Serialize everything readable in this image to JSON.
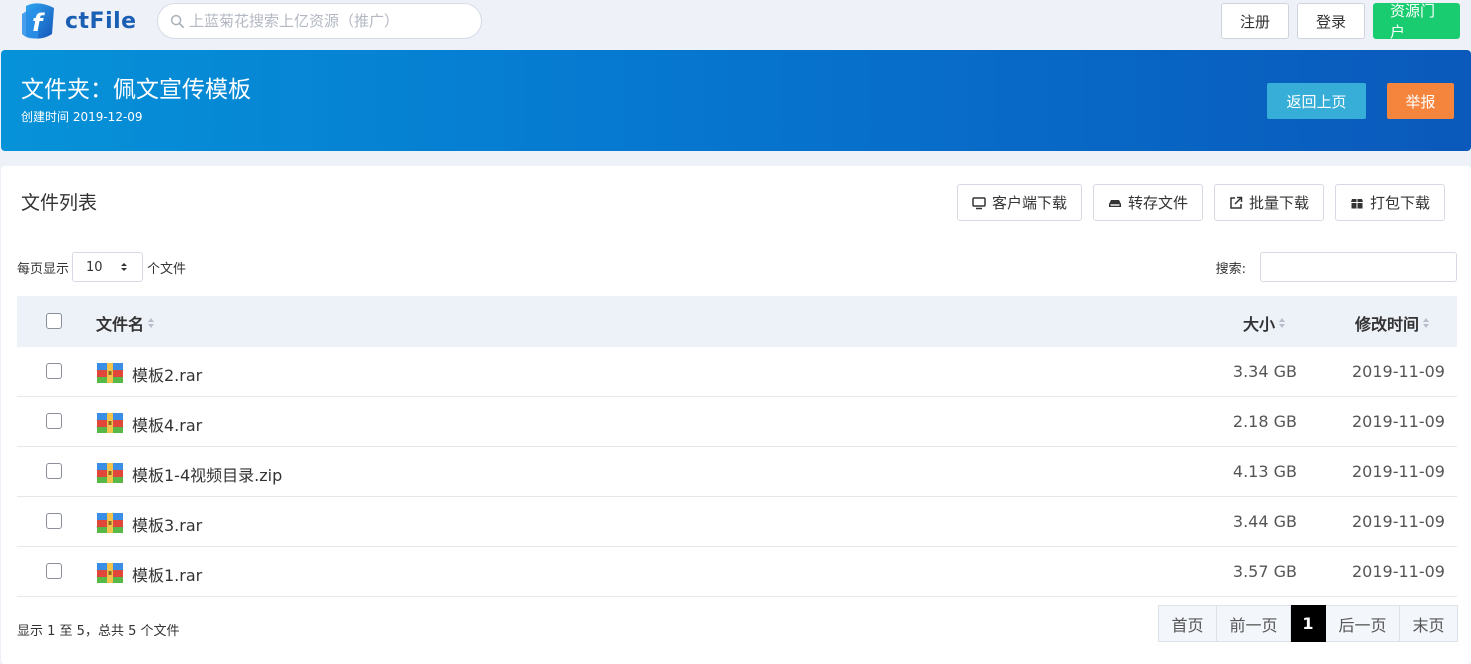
{
  "header": {
    "logo_text": "ctFile",
    "search_placeholder": "上蓝菊花搜索上亿资源（推广）",
    "register_label": "注册",
    "login_label": "登录",
    "portal_label": "资源门户"
  },
  "banner": {
    "title": "文件夹：佩文宣传模板",
    "created": "创建时间 2019-12-09",
    "back_label": "返回上页",
    "report_label": "举报"
  },
  "list": {
    "title": "文件列表",
    "tools": {
      "client_download": "客户端下载",
      "save_files": "转存文件",
      "batch_download": "批量下载",
      "pack_download": "打包下载"
    },
    "per_page_prefix": "每页显示",
    "per_page_value": "10",
    "per_page_suffix": "个文件",
    "search_label": "搜索:",
    "columns": {
      "name": "文件名",
      "size": "大小",
      "modified": "修改时间"
    },
    "rows": [
      {
        "name": "模板2.rar",
        "size": "3.34 GB",
        "modified": "2019-11-09"
      },
      {
        "name": "模板4.rar",
        "size": "2.18 GB",
        "modified": "2019-11-09"
      },
      {
        "name": "模板1-4视频目录.zip",
        "size": "4.13 GB",
        "modified": "2019-11-09"
      },
      {
        "name": "模板3.rar",
        "size": "3.44 GB",
        "modified": "2019-11-09"
      },
      {
        "name": "模板1.rar",
        "size": "3.57 GB",
        "modified": "2019-11-09"
      }
    ],
    "info": "显示 1 至 5，总共 5 个文件",
    "pager": {
      "first": "首页",
      "prev": "前一页",
      "current": "1",
      "next": "后一页",
      "last": "末页"
    }
  },
  "colors": {
    "banner_start": "#0692d8",
    "banner_end": "#0a59bb",
    "portal_green": "#19cc70",
    "back_blue": "#36aed8",
    "report_orange": "#f5843d"
  }
}
